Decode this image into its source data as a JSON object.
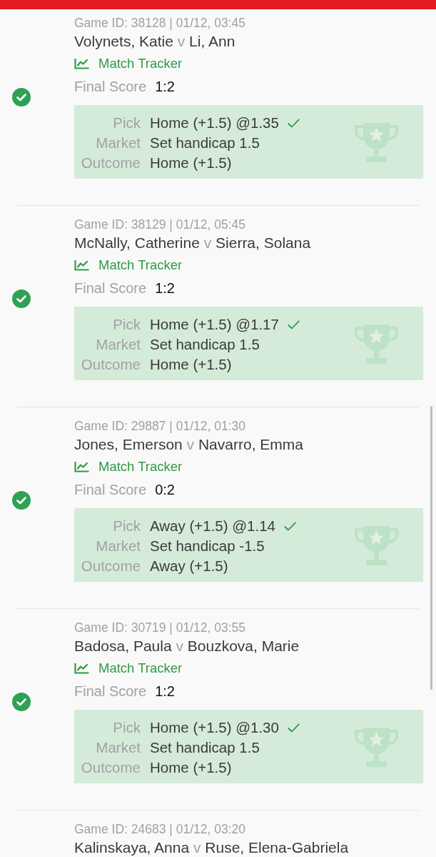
{
  "bets": [
    {
      "game_line": "Game ID: 38128 | 01/12, 03:45",
      "home": "Volynets, Katie",
      "versus": "v",
      "away": "Li, Ann",
      "tracker_link": "Match Tracker",
      "score_label": "Final Score",
      "score": "1:2",
      "won": true,
      "details": [
        {
          "label": "Pick",
          "value": "Home (+1.5) @1.35",
          "kind": "pick"
        },
        {
          "label": "Market",
          "value": "Set handicap 1.5",
          "kind": "plain"
        },
        {
          "label": "Outcome",
          "value": "Home (+1.5)",
          "kind": "plain"
        }
      ]
    },
    {
      "game_line": "Game ID: 38129 | 01/12, 05:45",
      "home": "McNally, Catherine",
      "versus": "v",
      "away": "Sierra, Solana",
      "tracker_link": "Match Tracker",
      "score_label": "Final Score",
      "score": "1:2",
      "won": true,
      "details": [
        {
          "label": "Pick",
          "value": "Home (+1.5) @1.17",
          "kind": "pick"
        },
        {
          "label": "Market",
          "value": "Set handicap 1.5",
          "kind": "plain"
        },
        {
          "label": "Outcome",
          "value": "Home (+1.5)",
          "kind": "plain"
        }
      ]
    },
    {
      "game_line": "Game ID: 29887 | 01/12, 01:30",
      "home": "Jones, Emerson",
      "versus": "v",
      "away": "Navarro, Emma",
      "tracker_link": "Match Tracker",
      "score_label": "Final Score",
      "score": "0:2",
      "won": true,
      "details": [
        {
          "label": "Pick",
          "value": "Away (+1.5) @1.14",
          "kind": "pick"
        },
        {
          "label": "Market",
          "value": "Set handicap -1.5",
          "kind": "plain"
        },
        {
          "label": "Outcome",
          "value": "Away (+1.5)",
          "kind": "plain"
        }
      ]
    },
    {
      "game_line": "Game ID: 30719 | 01/12, 03:55",
      "home": "Badosa, Paula",
      "versus": "v",
      "away": "Bouzkova, Marie",
      "tracker_link": "Match Tracker",
      "score_label": "Final Score",
      "score": "1:2",
      "won": true,
      "details": [
        {
          "label": "Pick",
          "value": "Home (+1.5) @1.30",
          "kind": "pick"
        },
        {
          "label": "Market",
          "value": "Set handicap 1.5",
          "kind": "plain"
        },
        {
          "label": "Outcome",
          "value": "Home (+1.5)",
          "kind": "plain"
        }
      ]
    },
    {
      "game_line": "Game ID: 24683 | 01/12, 03:20",
      "home": "Kalinskaya, Anna",
      "versus": "v",
      "away": "Ruse, Elena-Gabriela"
    }
  ]
}
